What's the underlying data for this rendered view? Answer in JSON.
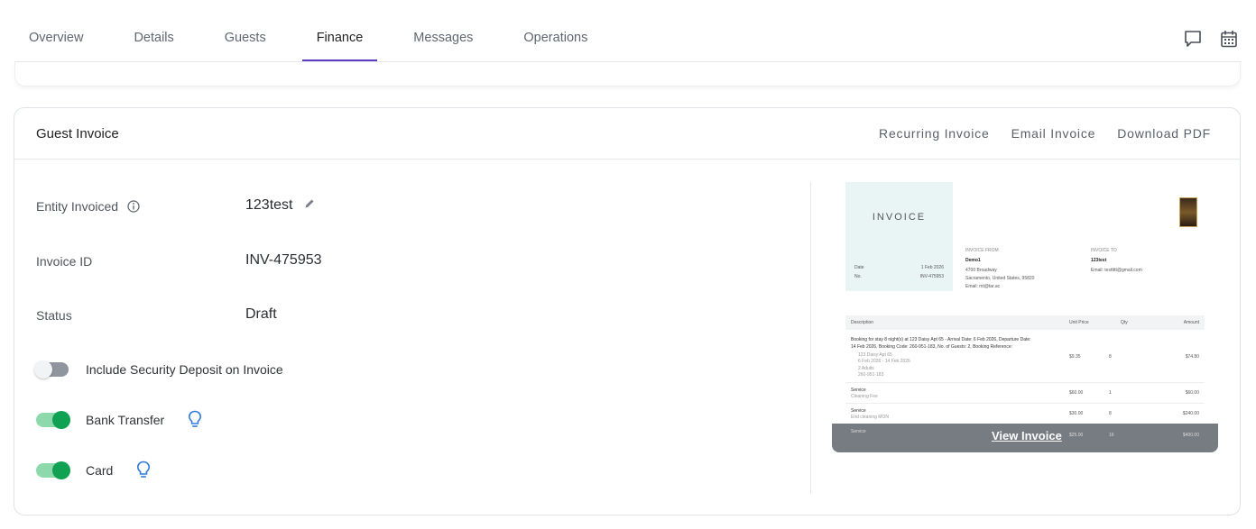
{
  "tabs": [
    {
      "label": "Overview"
    },
    {
      "label": "Details"
    },
    {
      "label": "Guests"
    },
    {
      "label": "Finance",
      "active": true
    },
    {
      "label": "Messages"
    },
    {
      "label": "Operations"
    }
  ],
  "top_icons": [
    "chat-bubble-icon",
    "calendar-icon"
  ],
  "invoice_card": {
    "title": "Guest Invoice",
    "actions": {
      "recurring": "Recurring Invoice",
      "email": "Email Invoice",
      "download": "Download PDF"
    },
    "fields": {
      "entity_label": "Entity Invoiced",
      "entity_value": "123test",
      "id_label": "Invoice ID",
      "id_value": "INV-475953",
      "status_label": "Status",
      "status_value": "Draft"
    },
    "toggles": {
      "security_deposit": {
        "label": "Include Security Deposit on Invoice",
        "on": false
      },
      "bank_transfer": {
        "label": "Bank Transfer",
        "on": true
      },
      "card": {
        "label": "Card",
        "on": true
      }
    }
  },
  "preview": {
    "title": "INVOICE",
    "date_label": "Date",
    "date_value": "1 Feb 2026",
    "no_label": "No.",
    "no_value": "INV-475953",
    "from_heading": "INVOICE FROM",
    "from_name": "Demo1",
    "from_address1": "4700 Broadway",
    "from_address2": "Sacramento, United States, 95820",
    "from_email": "Email: mt@tar.ac",
    "to_heading": "INVOICE TO",
    "to_name": "123test",
    "to_email": "Email: testtttt@gmail.com",
    "table_headers": {
      "description": "Description",
      "unit_price": "Unit Price",
      "qty": "Qty",
      "amount": "Amount"
    },
    "booking_line1": "Booking for stay 8 night(s) at 123 Daisy Apt 65 - Arrival Date: 6 Feb 2026, Departure Date:",
    "booking_line2": "14 Feb 2026, Booking Code: 260-951-183, No. of Guests: 2, Booking Reference:",
    "booking_sub1": "123 Daisy Apt 65",
    "booking_sub2": "6 Feb 2026 - 14 Feb 2026",
    "booking_sub3": "2 Adults",
    "booking_sub4": "260-951-183",
    "rows": [
      {
        "desc": "",
        "unit": "$9.35",
        "qty": "8",
        "amount": "$74.80"
      },
      {
        "desc": "Service",
        "sub": "Cleaning Fee",
        "unit": "$60.00",
        "qty": "1",
        "amount": "$60.00"
      },
      {
        "desc": "Service",
        "sub": "End cleaning MON",
        "unit": "$30.00",
        "qty": "8",
        "amount": "$240.00"
      },
      {
        "desc": "Service",
        "sub": "",
        "unit": "$25.00",
        "qty": "16",
        "amount": "$400.00"
      }
    ],
    "view_label": "View Invoice"
  }
}
